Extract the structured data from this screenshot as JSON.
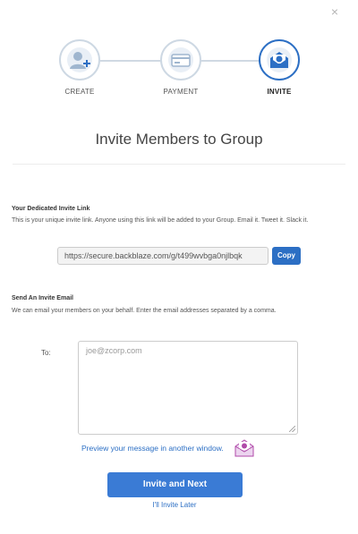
{
  "dialog": {
    "close_label": "×"
  },
  "stepper": {
    "steps": [
      {
        "label": "CREATE",
        "icon": "add-user-icon",
        "active": false
      },
      {
        "label": "PAYMENT",
        "icon": "credit-card-icon",
        "active": false
      },
      {
        "label": "INVITE",
        "icon": "envelope-icon",
        "active": true
      }
    ],
    "colors": {
      "active_border": "#2c6fc4",
      "inactive_border": "#cdd8e3",
      "icon_fill": "#9fb6cf",
      "connector": "#cfd9e3"
    }
  },
  "page": {
    "title": "Invite Members to Group"
  },
  "invite_link": {
    "heading": "Your Dedicated Invite Link",
    "description": "This is your unique invite link. Anyone using this link will be added to your Group. Email it. Tweet it. Slack it.",
    "url": "https://secure.backblaze.com/g/t499wvbga0njlbqk",
    "copy_label": "Copy"
  },
  "invite_email": {
    "heading": "Send An Invite Email",
    "description": "We can email your members on your behalf. Enter the email addresses separated by a comma.",
    "to_label": "To:",
    "placeholder": "joe@zcorp.com",
    "value": "",
    "preview_label": "Preview your message in another window.",
    "preview_icon": "envelope-preview-icon"
  },
  "actions": {
    "primary_label": "Invite and Next",
    "secondary_label": "I'll Invite Later",
    "primary_color": "#3a7bd5",
    "link_color": "#2c6fc4"
  }
}
